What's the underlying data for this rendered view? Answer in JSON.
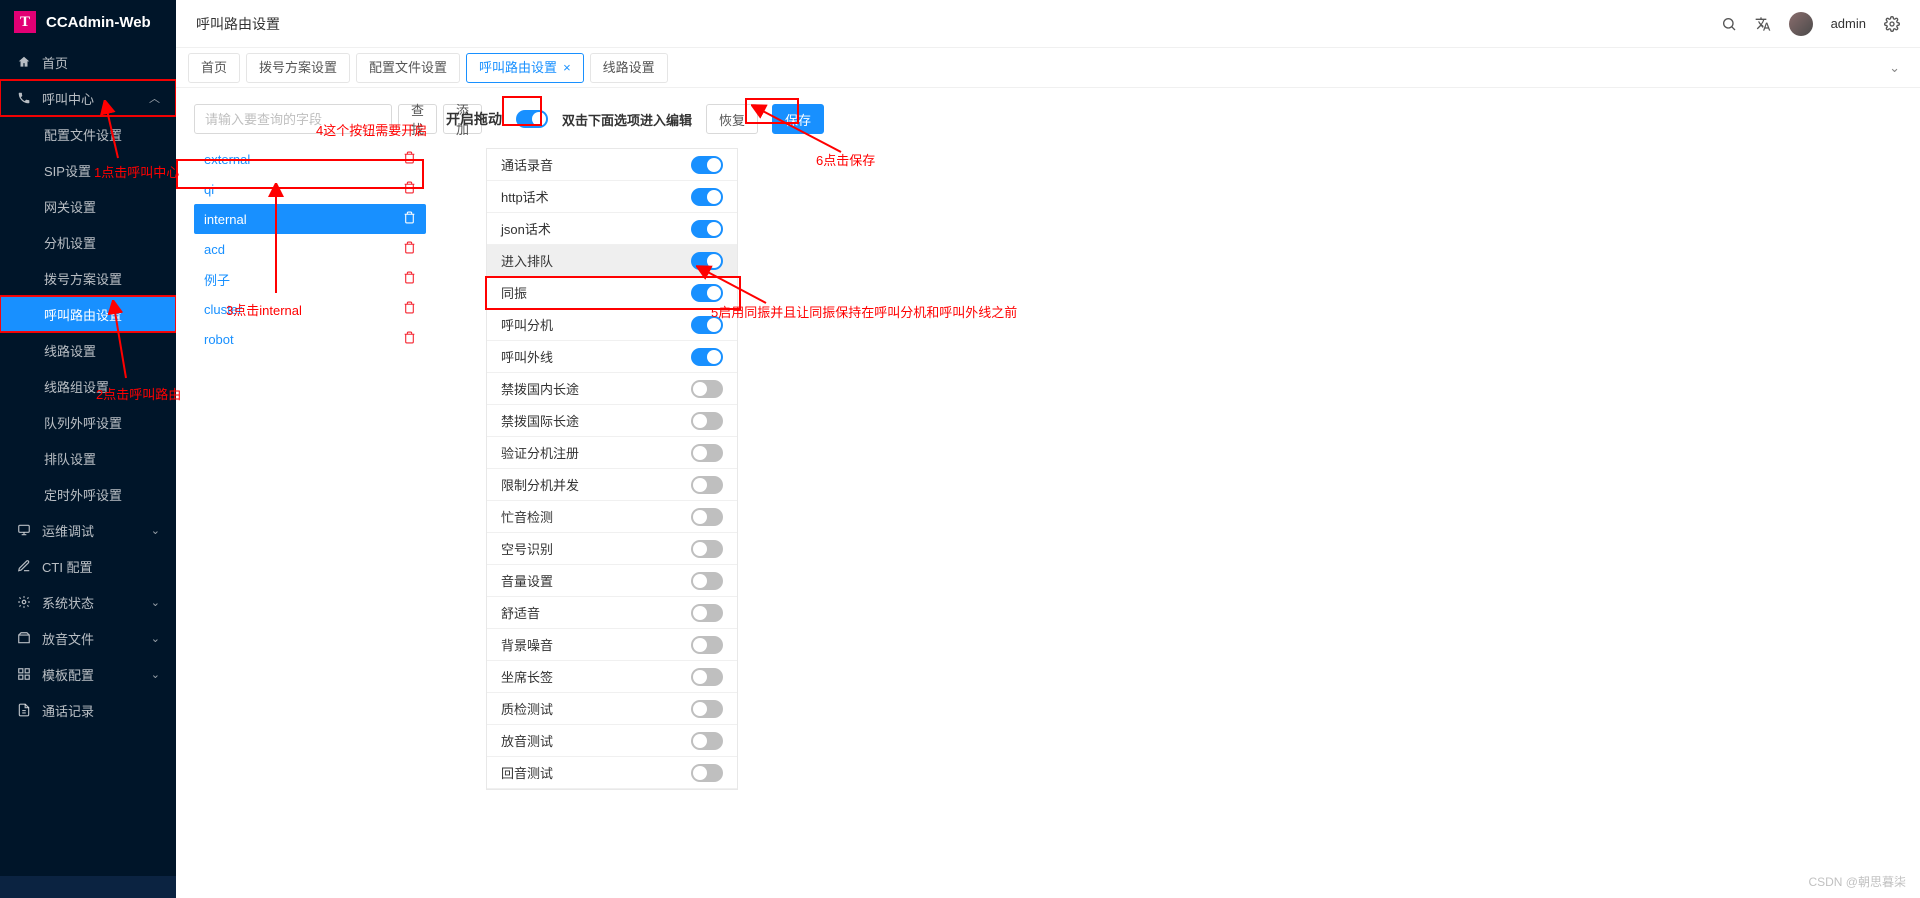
{
  "brand": "CCAdmin-Web",
  "breadcrumb": "呼叫路由设置",
  "user": {
    "name": "admin"
  },
  "sidebar": {
    "home": "首页",
    "callCenter": "呼叫中心",
    "items": [
      "配置文件设置",
      "SIP设置",
      "网关设置",
      "分机设置",
      "拨号方案设置",
      "呼叫路由设置",
      "线路设置",
      "线路组设置",
      "队列外呼设置",
      "排队设置",
      "定时外呼设置"
    ],
    "groups": [
      "运维调试",
      "CTI 配置",
      "系统状态",
      "放音文件",
      "模板配置",
      "通话记录"
    ],
    "footer": ""
  },
  "tabs": [
    {
      "label": "首页",
      "active": false,
      "closable": false
    },
    {
      "label": "拨号方案设置",
      "active": false,
      "closable": false
    },
    {
      "label": "配置文件设置",
      "active": false,
      "closable": false
    },
    {
      "label": "呼叫路由设置",
      "active": true,
      "closable": true
    },
    {
      "label": "线路设置",
      "active": false,
      "closable": false
    }
  ],
  "search": {
    "placeholder": "请输入要查询的字段",
    "find": "查找",
    "add": "添加"
  },
  "routes": [
    "external",
    "qi",
    "internal",
    "acd",
    "例子",
    "cluster",
    "robot"
  ],
  "selectedRoute": "internal",
  "toolbar": {
    "dragLabel": "开启拖动",
    "hint": "双击下面选项进入编辑",
    "restore": "恢复",
    "save": "保存"
  },
  "options": [
    {
      "label": "通话录音",
      "on": true
    },
    {
      "label": "http话术",
      "on": true
    },
    {
      "label": "json话术",
      "on": true
    },
    {
      "label": "进入排队",
      "on": true,
      "hovered": true
    },
    {
      "label": "同振",
      "on": true
    },
    {
      "label": "呼叫分机",
      "on": true
    },
    {
      "label": "呼叫外线",
      "on": true
    },
    {
      "label": "禁拨国内长途",
      "on": false
    },
    {
      "label": "禁拨国际长途",
      "on": false
    },
    {
      "label": "验证分机注册",
      "on": false
    },
    {
      "label": "限制分机并发",
      "on": false
    },
    {
      "label": "忙音检测",
      "on": false
    },
    {
      "label": "空号识别",
      "on": false
    },
    {
      "label": "音量设置",
      "on": false
    },
    {
      "label": "舒适音",
      "on": false
    },
    {
      "label": "背景噪音",
      "on": false
    },
    {
      "label": "坐席长签",
      "on": false
    },
    {
      "label": "质检测试",
      "on": false
    },
    {
      "label": "放音测试",
      "on": false
    },
    {
      "label": "回音测试",
      "on": false
    }
  ],
  "annotations": {
    "a1": "1点击呼叫中心",
    "a2": "2点击呼叫路由",
    "a3": "3点击internal",
    "a4": "4这个按钮需要开启",
    "a5": "5启用同振并且让同振保持在呼叫分机和呼叫外线之前",
    "a6": "6点击保存"
  },
  "watermark": "CSDN @朝思暮柒"
}
